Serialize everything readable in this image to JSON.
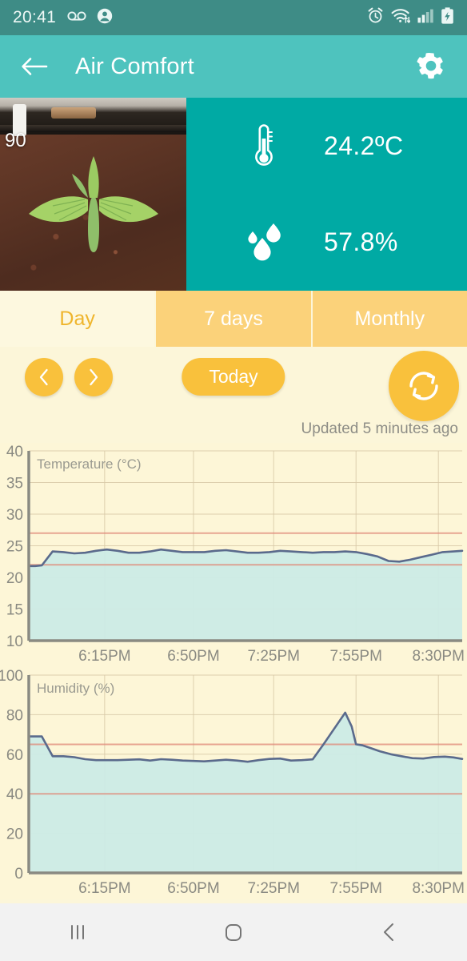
{
  "status_bar": {
    "time": "20:41",
    "icons": [
      "voicemail-icon",
      "contact-icon",
      "alarm-icon",
      "wifi-icon",
      "signal-icon",
      "battery-charging-icon"
    ]
  },
  "app_bar": {
    "back_label": "back-arrow",
    "title": "Air Comfort",
    "settings_label": "settings"
  },
  "hero": {
    "photo": {
      "overlay_value": "90",
      "alt": "seedling-photo"
    },
    "readings": [
      {
        "icon": "thermometer-icon",
        "value": "24.2ºC"
      },
      {
        "icon": "humidity-droplets-icon",
        "value": "57.8%"
      }
    ]
  },
  "tabs": [
    {
      "label": "Day",
      "active": true
    },
    {
      "label": "7 days",
      "active": false
    },
    {
      "label": "Monthly",
      "active": false
    }
  ],
  "controls": {
    "prev_label": "‹",
    "next_label": "›",
    "today_label": "Today",
    "refresh_label": "refresh",
    "updated_text": "Updated 5 minutes ago"
  },
  "colors": {
    "status_bar": "#3E8C86",
    "app_bar": "#4EC3BE",
    "readings_panel": "#00AAA4",
    "accent_amber": "#F9C13C",
    "tab_bar": "#FBD27A",
    "page_background": "#FCF6D9",
    "chart_background": "#FDF6D7",
    "chart_line": "#5A6A8C",
    "chart_fill": "#CCEBE6",
    "threshold_line": "#E08A7A",
    "grid_line": "#D8C9A8"
  },
  "chart_data": [
    {
      "type": "area",
      "title": "Temperature (°C)",
      "xlabel": "",
      "ylabel": "Temperature (°C)",
      "ylim": [
        10,
        40
      ],
      "yticks": [
        10,
        15,
        20,
        25,
        30,
        35,
        40
      ],
      "grid": true,
      "legend": "none",
      "xticks": [
        "6:15PM",
        "6:50PM",
        "7:25PM",
        "7:55PM",
        "8:30PM"
      ],
      "xtick_positions": [
        0.175,
        0.38,
        0.565,
        0.755,
        0.945
      ],
      "thresholds": [
        {
          "name": "upper-threshold",
          "value": 27
        },
        {
          "name": "lower-threshold",
          "value": 22
        }
      ],
      "x": [
        0.0,
        0.015,
        0.03,
        0.055,
        0.08,
        0.105,
        0.13,
        0.155,
        0.18,
        0.205,
        0.23,
        0.255,
        0.28,
        0.305,
        0.33,
        0.355,
        0.38,
        0.405,
        0.43,
        0.455,
        0.48,
        0.505,
        0.53,
        0.555,
        0.58,
        0.605,
        0.63,
        0.655,
        0.68,
        0.705,
        0.73,
        0.755,
        0.78,
        0.805,
        0.83,
        0.855,
        0.88,
        0.905,
        0.93,
        0.955,
        0.98,
        1.0
      ],
      "values": [
        21.8,
        21.8,
        21.9,
        24.1,
        24.0,
        23.8,
        23.9,
        24.2,
        24.4,
        24.2,
        23.9,
        23.9,
        24.1,
        24.4,
        24.2,
        24.0,
        24.0,
        24.0,
        24.2,
        24.3,
        24.1,
        23.9,
        23.9,
        24.0,
        24.2,
        24.1,
        24.0,
        23.9,
        24.0,
        24.0,
        24.1,
        24.0,
        23.7,
        23.3,
        22.6,
        22.5,
        22.8,
        23.2,
        23.6,
        24.0,
        24.1,
        24.2
      ]
    },
    {
      "type": "area",
      "title": "Humidity (%)",
      "xlabel": "",
      "ylabel": "Humidity (%)",
      "ylim": [
        0,
        100
      ],
      "yticks": [
        0,
        20,
        40,
        60,
        80,
        100
      ],
      "grid": true,
      "legend": "none",
      "xticks": [
        "6:15PM",
        "6:50PM",
        "7:25PM",
        "7:55PM",
        "8:30PM"
      ],
      "xtick_positions": [
        0.175,
        0.38,
        0.565,
        0.755,
        0.945
      ],
      "thresholds": [
        {
          "name": "upper-threshold",
          "value": 65
        },
        {
          "name": "lower-threshold",
          "value": 40
        }
      ],
      "x": [
        0.0,
        0.015,
        0.03,
        0.055,
        0.08,
        0.105,
        0.13,
        0.155,
        0.18,
        0.205,
        0.23,
        0.255,
        0.28,
        0.305,
        0.33,
        0.355,
        0.38,
        0.405,
        0.43,
        0.455,
        0.48,
        0.505,
        0.53,
        0.555,
        0.58,
        0.605,
        0.63,
        0.655,
        0.68,
        0.705,
        0.73,
        0.745,
        0.755,
        0.77,
        0.79,
        0.81,
        0.835,
        0.86,
        0.885,
        0.91,
        0.935,
        0.96,
        0.98,
        1.0
      ],
      "values": [
        69,
        69,
        69,
        59,
        59,
        58.5,
        57.5,
        57,
        57,
        57,
        57.2,
        57.4,
        56.8,
        57.5,
        57.2,
        56.8,
        56.6,
        56.4,
        56.8,
        57.2,
        56.8,
        56.2,
        57,
        57.6,
        57.8,
        56.8,
        57,
        57.4,
        65,
        73,
        81,
        74,
        65,
        64.5,
        63,
        61.5,
        60,
        59,
        58,
        57.8,
        58.6,
        58.8,
        58.4,
        57.6
      ]
    }
  ],
  "nav_bar": {
    "recents_label": "recents",
    "home_label": "home",
    "back_label": "back"
  }
}
